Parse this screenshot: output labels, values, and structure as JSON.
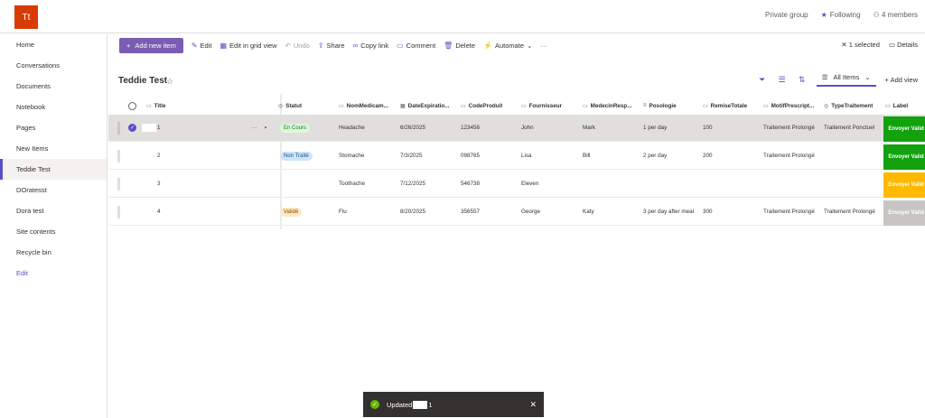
{
  "header": {
    "logo": "Tt",
    "private_group": "Private group",
    "following": "Following",
    "members": "4 members"
  },
  "sidebar": {
    "items": [
      {
        "label": "Home"
      },
      {
        "label": "Conversations"
      },
      {
        "label": "Documents"
      },
      {
        "label": "Notebook"
      },
      {
        "label": "Pages"
      },
      {
        "label": "New Items"
      },
      {
        "label": "Teddie Test",
        "active": true
      },
      {
        "label": "DOratesst"
      },
      {
        "label": "Dora test"
      },
      {
        "label": "Site contents"
      },
      {
        "label": "Recycle bin"
      },
      {
        "label": "Edit"
      }
    ]
  },
  "toolbar": {
    "add_new_item": "Add new item",
    "edit": "Edit",
    "edit_grid": "Edit in grid view",
    "undo": "Undo",
    "share": "Share",
    "copy_link": "Copy link",
    "comment": "Comment",
    "delete": "Delete",
    "automate": "Automate",
    "more": "···",
    "selected": "1 selected",
    "details": "Details"
  },
  "view": {
    "list_title": "Teddie Test",
    "all_items": "All Items",
    "add_view": "Add view"
  },
  "columns": [
    "Title",
    "Statut",
    "NomMedicam...",
    "DateExpiratio...",
    "CodeProduit",
    "Fournisseur",
    "MedecinResp...",
    "Posologie",
    "RemiseTotale",
    "MotifPrescript...",
    "TypeTraitement",
    "Label"
  ],
  "rows": [
    {
      "title": "1",
      "statut": "En Cours",
      "nom": "Headache",
      "date": "6/26/2025",
      "code": "123456",
      "fournisseur": "John",
      "medecin": "Mark",
      "posologie": "1 per day",
      "remise": "100",
      "motif": "Traitement Prolongé",
      "type": "Traitement Ponctuel",
      "label": "Envoyer Valid",
      "label_color": "#13a10e"
    },
    {
      "title": "2",
      "statut": "Non Traité",
      "nom": "Stomache",
      "date": "7/3/2025",
      "code": "098765",
      "fournisseur": "Lisa",
      "medecin": "Bill",
      "posologie": "2 per day",
      "remise": "200",
      "motif": "Traitement Prolongé",
      "type": "",
      "label": "Envoyer Valid",
      "label_color": "#13a10e"
    },
    {
      "title": "3",
      "statut": "",
      "nom": "Toothache",
      "date": "7/12/2025",
      "code": "546738",
      "fournisseur": "Eleven",
      "medecin": "",
      "posologie": "",
      "remise": "",
      "motif": "",
      "type": "",
      "label": "Envoyer Valid",
      "label_color": "#ffb900"
    },
    {
      "title": "4",
      "statut": "Validé",
      "nom": "Flu",
      "date": "8/20/2025",
      "code": "356557",
      "fournisseur": "George",
      "medecin": "Katy",
      "posologie": "3 per day after meal",
      "remise": "300",
      "motif": "Traitement Prolongé",
      "type": "Traitement Prolongé",
      "label": "Envoyer Valid",
      "label_color": "#c8c6c4"
    }
  ],
  "toast": {
    "prefix": "Updated",
    "suffix": "1",
    "close": "✕"
  }
}
